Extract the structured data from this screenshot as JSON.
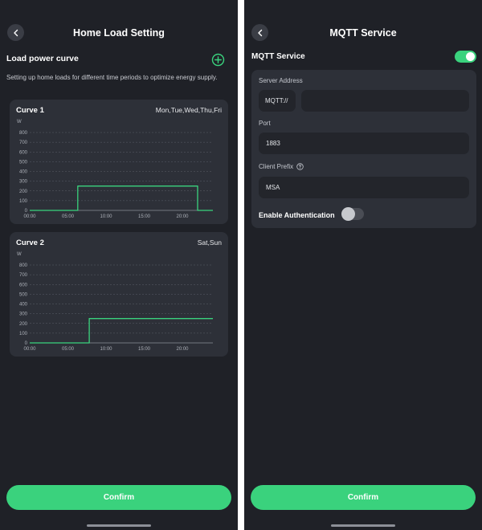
{
  "left": {
    "header": {
      "title": "Home Load Setting"
    },
    "section_title": "Load power curve",
    "description": "Setting up home loads for different time periods to optimize energy supply.",
    "curves": [
      {
        "name": "Curve 1",
        "days": "Mon,Tue,Wed,Thu,Fri"
      },
      {
        "name": "Curve 2",
        "days": "Sat,Sun"
      }
    ],
    "confirm_label": "Confirm"
  },
  "right": {
    "header": {
      "title": "MQTT Service"
    },
    "service_label": "MQTT Service",
    "service_enabled": true,
    "server_address": {
      "label": "Server Address",
      "prefix": "MQTT://",
      "value": ""
    },
    "port": {
      "label": "Port",
      "value": "1883"
    },
    "client_prefix": {
      "label": "Client Prefix",
      "value": "MSA"
    },
    "auth": {
      "label": "Enable Authentication",
      "enabled": false
    },
    "confirm_label": "Confirm"
  },
  "colors": {
    "accent": "#3ad27d",
    "background": "#1f2127",
    "card": "#2d3038",
    "input": "#23252b"
  },
  "chart_data": [
    {
      "type": "line",
      "title": "Curve 1",
      "ylabel": "W",
      "ylim": [
        0,
        800
      ],
      "yticks": [
        0,
        100,
        200,
        300,
        400,
        500,
        600,
        700,
        800
      ],
      "xlim": [
        0,
        24
      ],
      "xticks": [
        0,
        5,
        10,
        15,
        20
      ],
      "xtick_labels": [
        "00:00",
        "05:00",
        "10:00",
        "15:00",
        "20:00"
      ],
      "grid": true,
      "series": [
        {
          "x": [
            0,
            6.3,
            6.3,
            22,
            22,
            24
          ],
          "y": [
            0,
            0,
            250,
            250,
            0,
            0
          ]
        }
      ]
    },
    {
      "type": "line",
      "title": "Curve 2",
      "ylabel": "W",
      "ylim": [
        0,
        800
      ],
      "yticks": [
        0,
        100,
        200,
        300,
        400,
        500,
        600,
        700,
        800
      ],
      "xlim": [
        0,
        24
      ],
      "xticks": [
        0,
        5,
        10,
        15,
        20
      ],
      "xtick_labels": [
        "00:00",
        "05:00",
        "10:00",
        "15:00",
        "20:00"
      ],
      "grid": true,
      "series": [
        {
          "x": [
            0,
            7.8,
            7.8,
            24
          ],
          "y": [
            0,
            0,
            250,
            250
          ]
        }
      ]
    }
  ]
}
